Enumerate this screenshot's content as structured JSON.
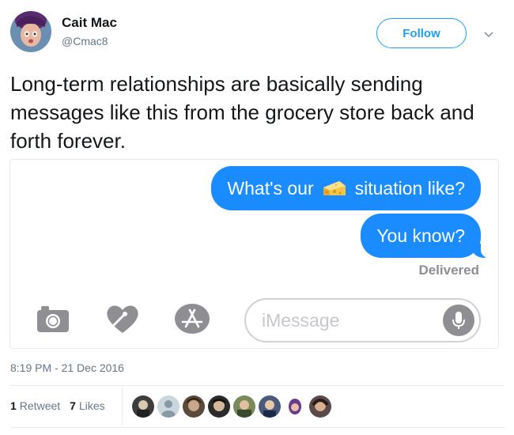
{
  "author": {
    "name": "Cait Mac",
    "handle": "@Cmac8",
    "follow_label": "Follow"
  },
  "tweet": {
    "text": "Long-term relationships are basically sending messages like this from the grocery store back and forth forever."
  },
  "screenshot": {
    "message1_before": "What's our",
    "message1_emoji": "cheese-wedge-icon",
    "message1_after": "situation like?",
    "message2": "You know?",
    "status": "Delivered",
    "input_placeholder": "iMessage",
    "bubble_color": "#1a8cff"
  },
  "meta": {
    "timestamp": "8:19 PM - 21 Dec 2016",
    "retweets_count": "1",
    "retweets_label": "Retweet",
    "likes_count": "7",
    "likes_label": "Likes"
  },
  "colors": {
    "twitter_blue": "#1da1f2",
    "secondary_text": "#657786"
  }
}
